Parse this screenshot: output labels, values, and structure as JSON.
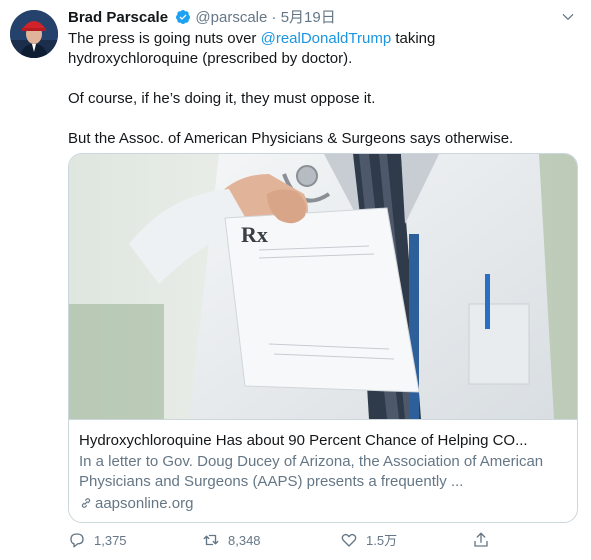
{
  "tweet": {
    "author_name": "Brad Parscale",
    "handle": "@parscale",
    "separator": "·",
    "date": "5月19日",
    "line1_prefix": "The press is going nuts over ",
    "mention": "@realDonaldTrump",
    "line1_suffix": " taking",
    "line2": "hydroxychloroquine (prescribed by doctor).",
    "para2": "Of course, if he’s doing it, they must oppose it.",
    "para3": "But the Assoc. of American Physicians & Surgeons says otherwise."
  },
  "card": {
    "title": "Hydroxychloroquine Has about 90 Percent Chance of Helping CO...",
    "description": "In a letter to Gov. Doug Ducey of Arizona, the Association of American Physicians and Surgeons (AAPS) presents a frequently ...",
    "domain": "aapsonline.org",
    "rx_mark": "Rx"
  },
  "actions": {
    "reply_count": "1,375",
    "retweet_count": "8,348",
    "like_count": "1.5万"
  },
  "colors": {
    "link": "#1b95e0",
    "secondary": "#657786",
    "border": "#ccd6dd",
    "verified": "#1da1f2"
  },
  "icons": [
    "verified-badge-icon",
    "chevron-down-icon",
    "link-icon",
    "reply-icon",
    "retweet-icon",
    "like-icon",
    "share-icon"
  ]
}
